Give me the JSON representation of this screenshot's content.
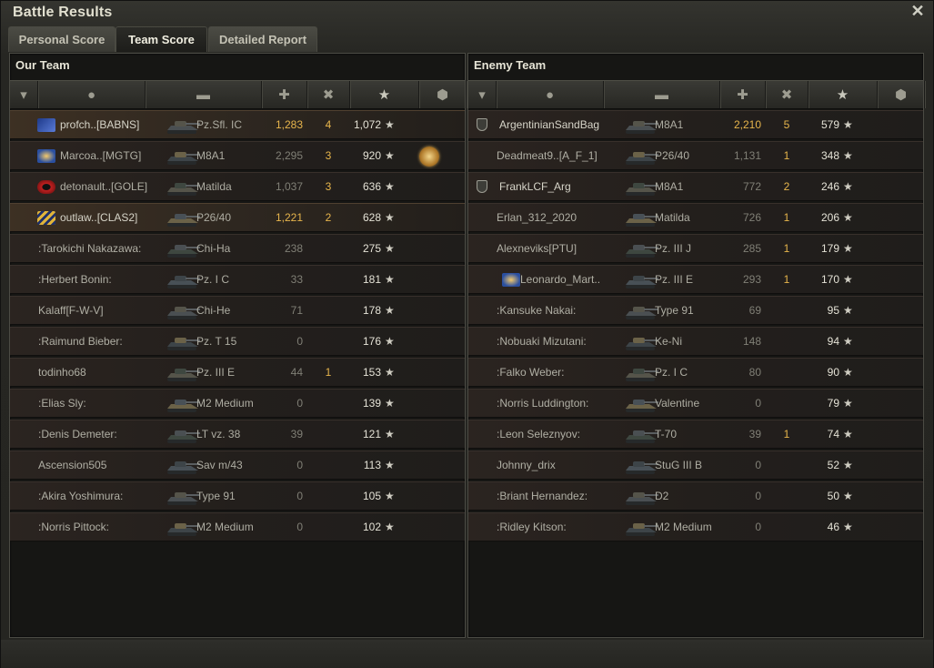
{
  "window": {
    "title": "Battle Results"
  },
  "tabs": [
    {
      "label": "Personal Score",
      "active": false
    },
    {
      "label": "Team Score",
      "active": true
    },
    {
      "label": "Detailed Report",
      "active": false
    }
  ],
  "our_team": {
    "title": "Our Team",
    "rows": [
      {
        "name": "profch..[BABNS]",
        "tank": "Pz.Sfl. IC",
        "damage": "1,283",
        "frags": "4",
        "xp": "1,072",
        "clan": "clan-blue-icon",
        "highlight": true
      },
      {
        "name": "Marcoa..[MGTG]",
        "tank": "M8A1",
        "damage": "2,295",
        "frags": "3",
        "xp": "920",
        "clan": "clan-star-icon",
        "medal": true
      },
      {
        "name": "detonault..[GOLE]",
        "tank": "Matilda",
        "damage": "1,037",
        "frags": "3",
        "xp": "636",
        "clan": "clan-red-icon"
      },
      {
        "name": "outlaw..[CLAS2]",
        "tank": "P26/40",
        "damage": "1,221",
        "frags": "2",
        "xp": "628",
        "clan": "clan-chevron-icon",
        "highlight": true
      },
      {
        "name": ":Tarokichi Nakazawa:",
        "tank": "Chi-Ha",
        "damage": "238",
        "frags": "",
        "xp": "275"
      },
      {
        "name": ":Herbert Bonin:",
        "tank": "Pz. I C",
        "damage": "33",
        "frags": "",
        "xp": "181"
      },
      {
        "name": "Kalaff[F-W-V]",
        "tank": "Chi-He",
        "damage": "71",
        "frags": "",
        "xp": "178"
      },
      {
        "name": ":Raimund Bieber:",
        "tank": "Pz. T 15",
        "damage": "0",
        "frags": "",
        "xp": "176"
      },
      {
        "name": "todinho68",
        "tank": "Pz. III E",
        "damage": "44",
        "frags": "1",
        "xp": "153"
      },
      {
        "name": ":Elias Sly:",
        "tank": "M2 Medium",
        "damage": "0",
        "frags": "",
        "xp": "139"
      },
      {
        "name": ":Denis Demeter:",
        "tank": "LT vz. 38",
        "damage": "39",
        "frags": "",
        "xp": "121"
      },
      {
        "name": "Ascension505",
        "tank": "Sav m/43",
        "damage": "0",
        "frags": "",
        "xp": "113"
      },
      {
        "name": ":Akira Yoshimura:",
        "tank": "Type 91",
        "damage": "0",
        "frags": "",
        "xp": "105"
      },
      {
        "name": ":Norris Pittock:",
        "tank": "M2 Medium",
        "damage": "0",
        "frags": "",
        "xp": "102"
      }
    ]
  },
  "enemy_team": {
    "title": "Enemy Team",
    "rows": [
      {
        "name": "ArgentinianSandBag",
        "tank": "M8A1",
        "damage": "2,210",
        "frags": "5",
        "xp": "579",
        "shield": true
      },
      {
        "name": "Deadmeat9..[A_F_1]",
        "tank": "P26/40",
        "damage": "1,131",
        "frags": "1",
        "xp": "348"
      },
      {
        "name": "FrankLCF_Arg",
        "tank": "M8A1",
        "damage": "772",
        "frags": "2",
        "xp": "246",
        "shield": true
      },
      {
        "name": "Erlan_312_2020",
        "tank": "Matilda",
        "damage": "726",
        "frags": "1",
        "xp": "206"
      },
      {
        "name": "Alexneviks[PTU]",
        "tank": "Pz. III J",
        "damage": "285",
        "frags": "1",
        "xp": "179"
      },
      {
        "name": "Leonardo_Mart..",
        "tank": "Pz. III E",
        "damage": "293",
        "frags": "1",
        "xp": "170",
        "clan": "clan-star-icon"
      },
      {
        "name": ":Kansuke Nakai:",
        "tank": "Type 91",
        "damage": "69",
        "frags": "",
        "xp": "95"
      },
      {
        "name": ":Nobuaki Mizutani:",
        "tank": "Ke-Ni",
        "damage": "148",
        "frags": "",
        "xp": "94"
      },
      {
        "name": ":Falko Weber:",
        "tank": "Pz. I C",
        "damage": "80",
        "frags": "",
        "xp": "90"
      },
      {
        "name": ":Norris Luddington:",
        "tank": "Valentine",
        "damage": "0",
        "frags": "",
        "xp": "79"
      },
      {
        "name": ":Leon Seleznyov:",
        "tank": "T-70",
        "damage": "39",
        "frags": "1",
        "xp": "74"
      },
      {
        "name": "Johnny_drix",
        "tank": "StuG III B",
        "damage": "0",
        "frags": "",
        "xp": "52"
      },
      {
        "name": ":Briant Hernandez:",
        "tank": "D2",
        "damage": "0",
        "frags": "",
        "xp": "50"
      },
      {
        "name": ":Ridley Kitson:",
        "tank": "M2 Medium",
        "damage": "0",
        "frags": "",
        "xp": "46"
      }
    ]
  },
  "columns": [
    "squad-icon",
    "player-icon",
    "tank-icon",
    "damage-icon",
    "frags-icon",
    "xp-star-icon",
    "medal-icon"
  ],
  "colors": {
    "accent_gold": "#e7b54c",
    "text": "#e4e2d6"
  }
}
